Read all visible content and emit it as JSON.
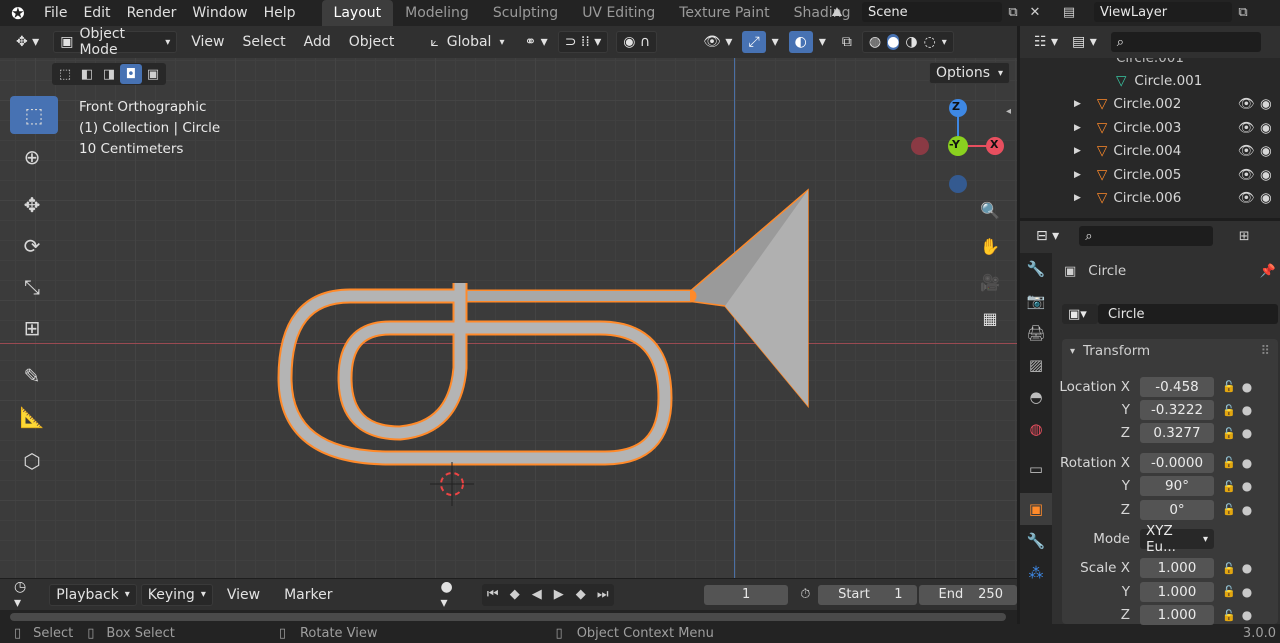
{
  "app": {
    "menus": [
      "File",
      "Edit",
      "Render",
      "Window",
      "Help"
    ],
    "workspaces": [
      "Layout",
      "Modeling",
      "Sculpting",
      "UV Editing",
      "Texture Paint",
      "Shading"
    ],
    "active_workspace": "Layout",
    "scene": "Scene",
    "view_layer": "ViewLayer",
    "version": "3.0.0"
  },
  "viewport_header": {
    "mode": "Object Mode",
    "menus": [
      "View",
      "Select",
      "Add",
      "Object"
    ],
    "transform_orientation": "Global",
    "options_label": "Options"
  },
  "viewport": {
    "view_name": "Front Orthographic",
    "collection_info": "(1) Collection | Circle",
    "scale_info": "10 Centimeters",
    "gizmo": {
      "z": "Z",
      "neg_y": "-Y",
      "x": "X"
    }
  },
  "timeline": {
    "menus": [
      "Playback",
      "Keying",
      "View",
      "Marker"
    ],
    "current_frame": "1",
    "start_label": "Start",
    "start": "1",
    "end_label": "End",
    "end": "250"
  },
  "status_bar": {
    "select": "Select",
    "box_select": "Box Select",
    "rotate_view": "Rotate View",
    "context_menu": "Object Context Menu"
  },
  "outliner": {
    "rows": [
      {
        "label": "Circle.001",
        "type": "mesh-data",
        "indent": true
      },
      {
        "label": "Circle.002",
        "type": "object"
      },
      {
        "label": "Circle.003",
        "type": "object"
      },
      {
        "label": "Circle.004",
        "type": "object"
      },
      {
        "label": "Circle.005",
        "type": "object"
      },
      {
        "label": "Circle.006",
        "type": "object"
      }
    ]
  },
  "properties": {
    "object_name": "Circle",
    "object_field": "Circle",
    "panel_title": "Transform",
    "location": {
      "label_x": "Location X",
      "x": "-0.458",
      "y": "-0.3222",
      "z": "0.3277"
    },
    "rotation": {
      "label_x": "Rotation X",
      "x": "-0.0000",
      "y": "90°",
      "z": "0°"
    },
    "mode_label": "Mode",
    "mode_value": "XYZ Eu...",
    "scale": {
      "label_x": "Scale X",
      "x": "1.000",
      "y": "1.000",
      "z": "1.000"
    },
    "axis_labels": {
      "y": "Y",
      "z": "Z"
    }
  },
  "colors": {
    "accent": "#4772b3",
    "selection_orange": "#ff8a2a",
    "x_axis": "#e84f5f",
    "y_axis": "#8ad11f",
    "z_axis": "#3e88e4"
  }
}
